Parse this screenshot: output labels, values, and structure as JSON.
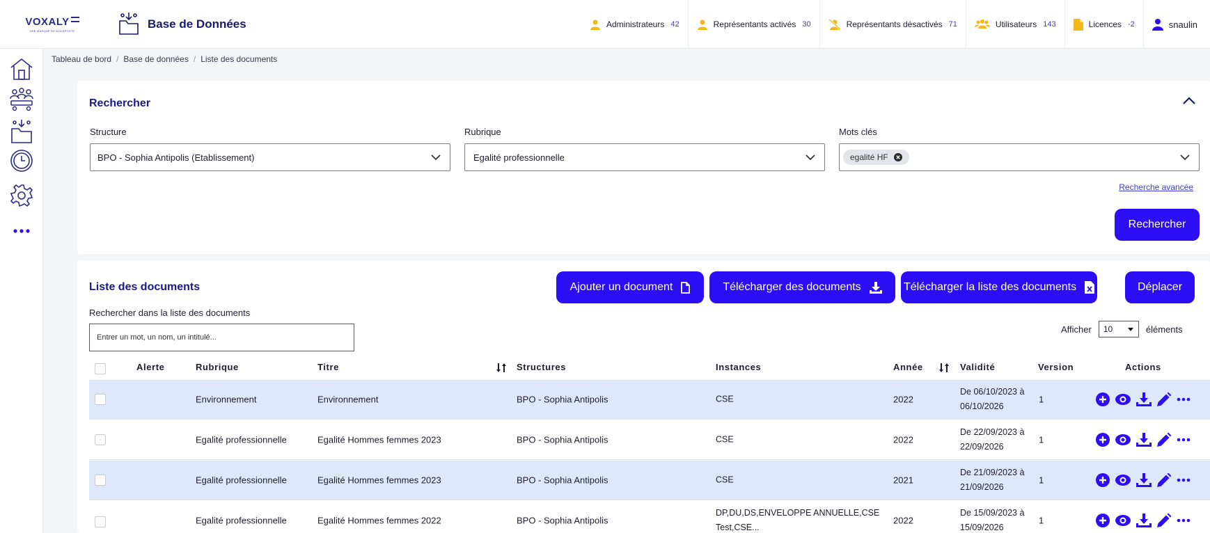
{
  "brand": {
    "logo_text": "VOXALY",
    "tagline": "UNE MARQUE DE DOCAPOSTE"
  },
  "module": {
    "title": "Base de Données"
  },
  "stats": [
    {
      "label": "Administrateurs",
      "count": "42",
      "icon": "admin-user-icon",
      "color": "#f5b81b"
    },
    {
      "label": "Représentants activés",
      "count": "30",
      "icon": "user-check-icon",
      "color": "#f5b81b"
    },
    {
      "label": "Représentants désactivés",
      "count": "71",
      "icon": "user-slash-icon",
      "color": "#f5b81b"
    },
    {
      "label": "Utilisateurs",
      "count": "143",
      "icon": "users-icon",
      "color": "#f5b81b"
    },
    {
      "label": "Licences",
      "count": "-2",
      "icon": "document-icon",
      "color": "#f5b81b"
    }
  ],
  "user": {
    "name": "snaulin",
    "icon": "user-icon"
  },
  "sidebar": [
    {
      "name": "home-icon"
    },
    {
      "name": "meeting-icon"
    },
    {
      "name": "database-icon"
    },
    {
      "name": "clock-icon"
    },
    {
      "name": "gear-icon"
    },
    {
      "name": "more-icon"
    }
  ],
  "breadcrumb": [
    "Tableau de bord",
    "Base de données",
    "Liste des documents"
  ],
  "search": {
    "title": "Rechercher",
    "structure_label": "Structure",
    "structure_value": "BPO - Sophia Antipolis (Etablissement)",
    "rubrique_label": "Rubrique",
    "rubrique_value": "Egalité professionnelle",
    "keywords_label": "Mots clés",
    "keyword_chip": "egalité HF",
    "advanced_link": "Recherche avancée",
    "submit": "Rechercher"
  },
  "docs": {
    "title": "Liste des documents",
    "add_btn": "Ajouter un document",
    "download_btn": "Télécharger des documents",
    "download_list_btn": "Télécharger la liste des documents",
    "move_btn": "Déplacer",
    "search_label": "Rechercher dans la liste des documents",
    "search_placeholder": "Entrer un mot, un nom, un intitulé...",
    "show_label": "Afficher",
    "show_value": "10",
    "show_suffix": "éléments",
    "columns": {
      "alerte": "Alerte",
      "rubrique": "Rubrique",
      "titre": "Titre",
      "structures": "Structures",
      "instances": "Instances",
      "annee": "Année",
      "validite": "Validité",
      "version": "Version",
      "actions": "Actions"
    },
    "rows": [
      {
        "rubrique": "Environnement",
        "titre": "Environnement",
        "structure": "BPO - Sophia Antipolis",
        "instances_1": "CSE",
        "instances_2": "",
        "annee": "2022",
        "validite_1": "De 06/10/2023 à",
        "validite_2": "06/10/2026",
        "version": "1"
      },
      {
        "rubrique": "Egalité professionnelle",
        "titre": "Egalité Hommes femmes 2023",
        "structure": "BPO - Sophia Antipolis",
        "instances_1": "CSE",
        "instances_2": "",
        "annee": "2022",
        "validite_1": "De 22/09/2023 à",
        "validite_2": "22/09/2026",
        "version": "1"
      },
      {
        "rubrique": "Egalité professionnelle",
        "titre": "Egalité Hommes femmes 2023",
        "structure": "BPO - Sophia Antipolis",
        "instances_1": "CSE",
        "instances_2": "",
        "annee": "2021",
        "validite_1": "De 21/09/2023 à",
        "validite_2": "21/09/2026",
        "version": "1"
      },
      {
        "rubrique": "Egalité professionnelle",
        "titre": "Egalité Hommes femmes 2022",
        "structure": "BPO - Sophia Antipolis",
        "instances_1": "DP,DU,DS,ENVELOPPE ANNUELLE,CSE",
        "instances_2": "Test,CSE...",
        "annee": "2022",
        "validite_1": "De 15/09/2023 à",
        "validite_2": "15/09/2026",
        "version": "1"
      }
    ]
  },
  "colors": {
    "primary": "#2d0df4",
    "title": "#1a1a8a",
    "accent_icon": "#f5b81b",
    "row_alt": "#dde8fb"
  }
}
